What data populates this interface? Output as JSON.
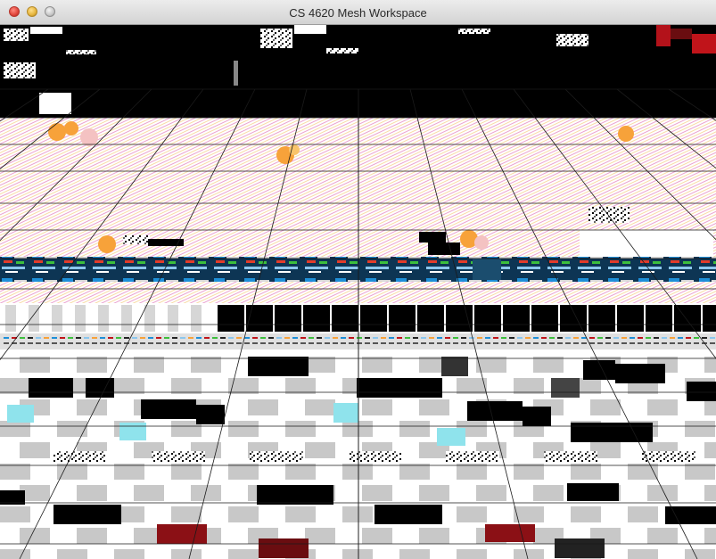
{
  "window": {
    "title": "CS 4620 Mesh Workspace"
  },
  "titlebar_buttons": {
    "close": "close-button",
    "minimize": "minimize-button",
    "zoom": "zoom-button"
  },
  "viewport": {
    "description_icon": "3d-render-canvas",
    "colors": {
      "background": "#000000",
      "grid": "#1a1a1a",
      "tile_white": "#ffffff",
      "tile_gray": "#c8c8c8",
      "tile_black": "#000000",
      "tile_cyan": "#8fe3ec",
      "accent_orange": "#f7a23a",
      "accent_pink": "#e58ac4",
      "accent_blue": "#1e6fb8",
      "accent_red": "#c0141a"
    }
  }
}
